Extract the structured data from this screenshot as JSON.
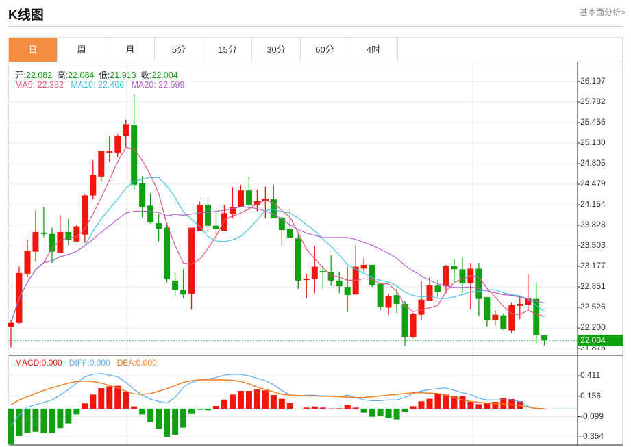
{
  "header": {
    "title": "K线图",
    "link": "基本面分析>"
  },
  "tabs": [
    {
      "label": "日",
      "active": true
    },
    {
      "label": "周"
    },
    {
      "label": "月"
    },
    {
      "label": "5分"
    },
    {
      "label": "15分"
    },
    {
      "label": "30分"
    },
    {
      "label": "60分"
    },
    {
      "label": "4时"
    }
  ],
  "ohlc_info": {
    "open_label": "开:",
    "open": "22.082",
    "high_label": "高:",
    "high": "22.084",
    "low_label": "低:",
    "low": "21.913",
    "close_label": "收:",
    "close": "22.004"
  },
  "ma_info": {
    "ma5": "MA5: 22.382",
    "ma10": "MA10: 22.466",
    "ma20": "MA20: 22.599"
  },
  "macd_info": {
    "macd": "MACD:0.000",
    "diff": "DIFF:0.000",
    "dea": "DEA:0.000"
  },
  "colors": {
    "up": "#f0160c",
    "down": "#11a011",
    "ma5": "#e8537a",
    "ma10": "#3cc6dc",
    "ma20": "#b65fcc",
    "diff": "#5aabf0",
    "dea": "#f57c20"
  },
  "chart_data": [
    {
      "type": "candlestick",
      "title": "K线图",
      "ylim": [
        21.875,
        26.107
      ],
      "yticks": [
        "26.107",
        "25.782",
        "25.456",
        "25.130",
        "24.805",
        "24.479",
        "24.154",
        "23.828",
        "23.503",
        "23.177",
        "22.851",
        "22.526",
        "22.200",
        "21.875"
      ],
      "last_price": "22.004",
      "ohlc": [
        [
          22.22,
          22.33,
          21.89,
          22.28
        ],
        [
          22.28,
          23.17,
          22.26,
          23.07
        ],
        [
          23.06,
          23.6,
          23.0,
          23.42
        ],
        [
          23.41,
          24.06,
          23.25,
          23.72
        ],
        [
          23.71,
          24.12,
          23.64,
          23.69
        ],
        [
          23.69,
          23.79,
          23.23,
          23.41
        ],
        [
          23.39,
          23.99,
          23.39,
          23.72
        ],
        [
          23.72,
          23.93,
          23.51,
          23.6
        ],
        [
          23.57,
          23.83,
          23.57,
          23.81
        ],
        [
          23.68,
          24.32,
          23.55,
          24.3
        ],
        [
          24.3,
          24.86,
          24.24,
          24.62
        ],
        [
          24.6,
          25.01,
          24.52,
          25.01
        ],
        [
          24.98,
          25.24,
          24.83,
          25.0
        ],
        [
          24.98,
          25.27,
          24.91,
          25.25
        ],
        [
          25.25,
          25.5,
          25.07,
          25.43
        ],
        [
          25.42,
          25.9,
          24.39,
          24.47
        ],
        [
          24.49,
          24.61,
          23.95,
          24.12
        ],
        [
          24.14,
          24.34,
          23.85,
          23.87
        ],
        [
          23.86,
          24.0,
          23.57,
          23.77
        ],
        [
          23.79,
          23.87,
          22.92,
          22.97
        ],
        [
          22.95,
          23.08,
          22.7,
          22.8
        ],
        [
          22.8,
          23.13,
          22.67,
          22.73
        ],
        [
          22.74,
          23.79,
          22.49,
          23.79
        ],
        [
          23.74,
          24.2,
          23.74,
          24.15
        ],
        [
          24.15,
          24.27,
          23.73,
          23.82
        ],
        [
          23.82,
          24.03,
          23.65,
          23.77
        ],
        [
          23.74,
          24.15,
          23.74,
          24.02
        ],
        [
          24.01,
          24.43,
          23.94,
          24.12
        ],
        [
          24.12,
          24.47,
          24.12,
          24.38
        ],
        [
          24.38,
          24.59,
          24.07,
          24.15
        ],
        [
          24.15,
          24.39,
          24.05,
          24.21
        ],
        [
          24.21,
          24.44,
          23.94,
          24.25
        ],
        [
          24.24,
          24.47,
          23.94,
          23.94
        ],
        [
          23.95,
          23.96,
          23.51,
          23.75
        ],
        [
          23.77,
          24.08,
          23.62,
          23.63
        ],
        [
          23.62,
          23.69,
          22.82,
          22.95
        ],
        [
          22.96,
          23.06,
          22.67,
          22.98
        ],
        [
          22.97,
          23.5,
          22.75,
          23.17
        ],
        [
          23.1,
          23.19,
          22.82,
          23.08
        ],
        [
          23.09,
          23.35,
          22.87,
          22.95
        ],
        [
          22.95,
          23.09,
          22.75,
          22.86
        ],
        [
          22.85,
          23.17,
          22.45,
          22.72
        ],
        [
          22.73,
          23.51,
          22.73,
          23.17
        ],
        [
          23.14,
          23.31,
          23.09,
          23.2
        ],
        [
          23.2,
          23.2,
          22.85,
          22.88
        ],
        [
          22.9,
          22.92,
          22.48,
          22.53
        ],
        [
          22.52,
          22.74,
          22.41,
          22.71
        ],
        [
          22.72,
          22.82,
          22.44,
          22.58
        ],
        [
          22.58,
          22.63,
          21.91,
          22.06
        ],
        [
          22.06,
          22.44,
          22.04,
          22.42
        ],
        [
          22.41,
          22.94,
          22.32,
          22.65
        ],
        [
          22.63,
          23.0,
          22.63,
          22.88
        ],
        [
          22.87,
          22.96,
          22.68,
          22.77
        ],
        [
          22.86,
          23.2,
          22.75,
          23.18
        ],
        [
          23.18,
          23.29,
          22.93,
          23.13
        ],
        [
          23.13,
          23.31,
          22.75,
          22.91
        ],
        [
          22.91,
          23.23,
          22.49,
          23.14
        ],
        [
          23.14,
          23.23,
          22.39,
          22.66
        ],
        [
          22.69,
          22.69,
          22.22,
          22.32
        ],
        [
          22.32,
          22.47,
          22.24,
          22.41
        ],
        [
          22.4,
          22.43,
          22.17,
          22.19
        ],
        [
          22.16,
          22.61,
          22.12,
          22.56
        ],
        [
          22.55,
          22.7,
          22.34,
          22.58
        ],
        [
          22.57,
          23.06,
          22.49,
          22.67
        ],
        [
          22.66,
          22.92,
          21.96,
          22.09
        ],
        [
          22.082,
          22.084,
          21.913,
          22.004
        ]
      ],
      "ma_periods": [
        5,
        10,
        20
      ]
    },
    {
      "type": "bar+line",
      "title": "MACD",
      "ylim": [
        -0.44,
        0.52
      ],
      "yticks": [
        "0.411",
        "0.156",
        "-0.099",
        "-0.354"
      ],
      "macd": [
        -0.443,
        -0.343,
        -0.3,
        -0.29,
        -0.306,
        -0.309,
        -0.243,
        -0.186,
        -0.072,
        0.066,
        0.177,
        0.257,
        0.28,
        0.286,
        0.215,
        0.029,
        -0.072,
        -0.163,
        -0.252,
        -0.352,
        -0.329,
        -0.237,
        -0.066,
        -0.014,
        -0.02,
        0.034,
        0.114,
        0.177,
        0.223,
        0.223,
        0.24,
        0.229,
        0.172,
        0.123,
        0.069,
        -0.003,
        0.014,
        0.029,
        0.014,
        0.003,
        0.006,
        0.049,
        0.014,
        -0.049,
        -0.1,
        -0.092,
        -0.12,
        -0.134,
        -0.043,
        0.031,
        0.092,
        0.123,
        0.186,
        0.177,
        0.157,
        0.157,
        0.086,
        0.057,
        0.077,
        0.086,
        0.134,
        0.12,
        0.092,
        0.0,
        0.0,
        0.0
      ],
      "diff": [
        -0.21,
        -0.08,
        0.02,
        0.05,
        0.08,
        0.11,
        0.17,
        0.24,
        0.32,
        0.4,
        0.43,
        0.44,
        0.42,
        0.4,
        0.33,
        0.24,
        0.17,
        0.12,
        0.09,
        0.07,
        0.14,
        0.27,
        0.33,
        0.36,
        0.37,
        0.39,
        0.42,
        0.43,
        0.43,
        0.41,
        0.38,
        0.35,
        0.3,
        0.23,
        0.17,
        0.16,
        0.17,
        0.17,
        0.16,
        0.16,
        0.15,
        0.17,
        0.14,
        0.11,
        0.1,
        0.1,
        0.11,
        0.11,
        0.14,
        0.19,
        0.22,
        0.24,
        0.25,
        0.26,
        0.23,
        0.2,
        0.18,
        0.13,
        0.11,
        0.11,
        0.11,
        0.11,
        0.09,
        0.03,
        0.0,
        0.0
      ],
      "dea": [
        0.05,
        0.11,
        0.15,
        0.19,
        0.23,
        0.26,
        0.29,
        0.32,
        0.34,
        0.345,
        0.34,
        0.32,
        0.29,
        0.26,
        0.22,
        0.185,
        0.18,
        0.19,
        0.22,
        0.25,
        0.29,
        0.33,
        0.35,
        0.36,
        0.36,
        0.36,
        0.36,
        0.355,
        0.34,
        0.31,
        0.27,
        0.24,
        0.21,
        0.18,
        0.17,
        0.165,
        0.16,
        0.16,
        0.155,
        0.155,
        0.15,
        0.145,
        0.14,
        0.14,
        0.15,
        0.16,
        0.17,
        0.18,
        0.19,
        0.2,
        0.2,
        0.195,
        0.19,
        0.17,
        0.14,
        0.11,
        0.09,
        0.08,
        0.07,
        0.065,
        0.06,
        0.05,
        0.04,
        0.02,
        0.005,
        0.0
      ]
    }
  ]
}
